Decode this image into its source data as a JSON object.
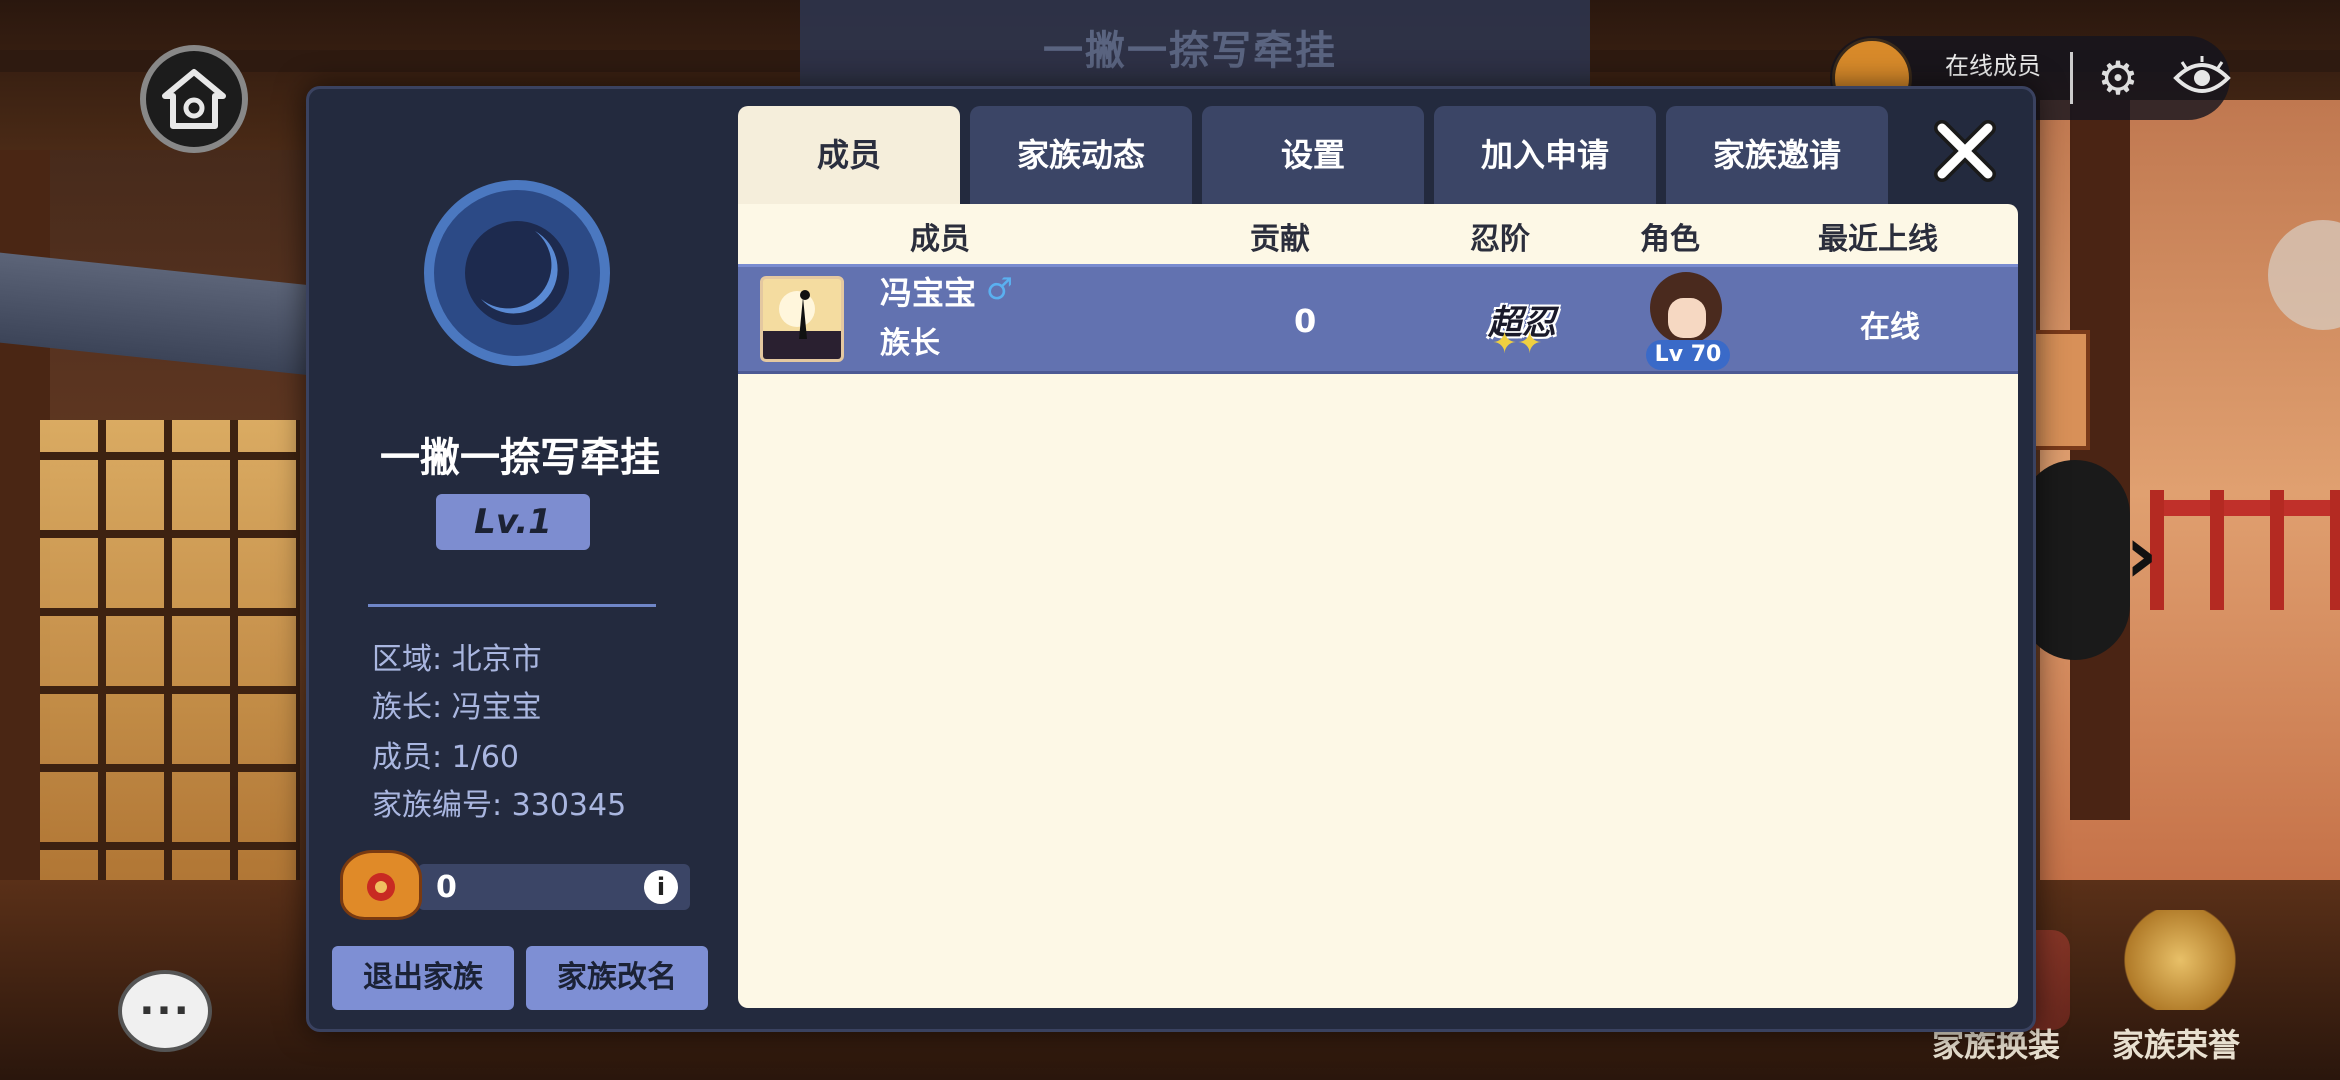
{
  "background": {
    "banner_title": "一撇一捺写牵挂"
  },
  "top_right": {
    "online_label": "在线成员",
    "online_count": ""
  },
  "icons": {
    "home": "house-icon",
    "gear": "gear-icon",
    "eye": "eye-icon",
    "chat": "chat-icon",
    "close": "close-icon"
  },
  "clan": {
    "name": "一撇一捺写牵挂",
    "level": "Lv.1",
    "region": "区域: 北京市",
    "leader": "族长: 冯宝宝",
    "members": "成员: 1/60",
    "clan_id": "家族编号: 330345",
    "coins": "0",
    "info_symbol": "i",
    "leave_button": "退出家族",
    "rename_button": "家族改名"
  },
  "tabs": [
    {
      "label": "成员",
      "active": true
    },
    {
      "label": "家族动态",
      "active": false
    },
    {
      "label": "设置",
      "active": false
    },
    {
      "label": "加入申请",
      "active": false
    },
    {
      "label": "家族邀请",
      "active": false
    }
  ],
  "table": {
    "headers": {
      "member": "成员",
      "contribution": "贡献",
      "rank": "忍阶",
      "character": "角色",
      "last_online": "最近上线"
    },
    "rows": [
      {
        "name": "冯宝宝",
        "gender_symbol": "♂",
        "role": "族长",
        "contribution": "0",
        "rank": "超忍",
        "character_level": "Lv 70",
        "last_online": "在线"
      }
    ]
  },
  "bottom": {
    "costume_label": "家族换装",
    "honor_label": "家族荣誉",
    "chat_glyph": "···"
  },
  "colors": {
    "panel_bg": "#232a3e",
    "tab_inactive": "#3b4566",
    "tab_active": "#f5eedb",
    "content_bg": "#fdf8e6",
    "row_highlight": "#6272b0",
    "button_blue": "#7e8fd4"
  }
}
